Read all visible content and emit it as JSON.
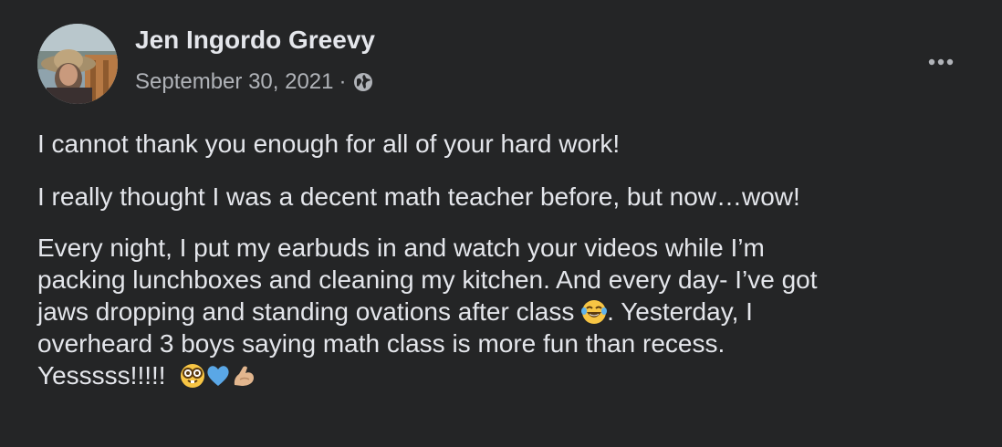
{
  "post": {
    "author": "Jen Ingordo Greevy",
    "date": "September 30, 2021",
    "separator": "·",
    "audience_icon": "globe-icon",
    "more_icon": "more-options-icon",
    "paragraphs": {
      "p1": "I cannot thank you enough for all of your hard work!",
      "p2": "I really thought I was a decent math teacher before, but now…wow!",
      "p3_line1": "Every night, I put my earbuds in and watch your videos while I’m",
      "p3_line2": "packing lunchboxes and cleaning my kitchen.  And every day- I’ve got",
      "p3_line3a": "jaws dropping and standing ovations after class",
      "p3_line3b": ". Yesterday, I",
      "p3_line4": "overheard 3 boys saying math class is more fun than recess.",
      "p3_line5": "Yesssss!!!!!"
    },
    "emojis": [
      "laughing-crying-emoji",
      "nerd-face-emoji",
      "blue-heart-emoji",
      "flexed-biceps-emoji"
    ]
  },
  "colors": {
    "background": "#242526",
    "primary_text": "#e4e6eb",
    "secondary_text": "#b0b3b8"
  }
}
